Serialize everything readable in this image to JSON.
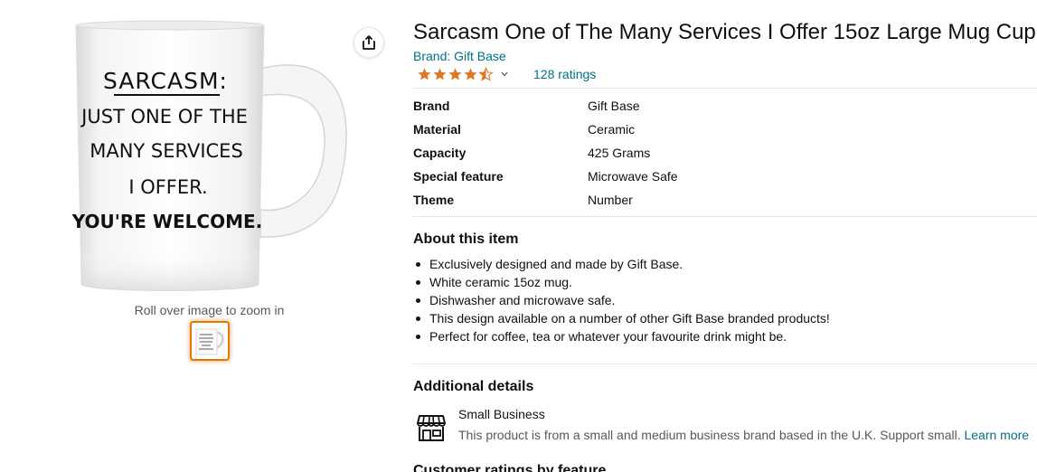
{
  "image": {
    "zoom_hint": "Roll over image to zoom in",
    "mug_text": [
      "SARCASM:",
      "JUST ONE OF THE",
      "MANY SERVICES",
      "I OFFER.",
      "YOU'RE WELCOME."
    ]
  },
  "product": {
    "title": "Sarcasm One of The Many Services I Offer 15oz Large Mug Cup",
    "brand_link": "Brand: Gift Base",
    "rating": 4.5,
    "ratings_count": "128 ratings",
    "star_color": "#de7921"
  },
  "specs": [
    {
      "key": "Brand",
      "value": "Gift Base"
    },
    {
      "key": "Material",
      "value": "Ceramic"
    },
    {
      "key": "Capacity",
      "value": "425 Grams"
    },
    {
      "key": "Special feature",
      "value": "Microwave Safe"
    },
    {
      "key": "Theme",
      "value": "Number"
    }
  ],
  "about": {
    "heading": "About this item",
    "bullets": [
      "Exclusively designed and made by Gift Base.",
      "White ceramic 15oz mug.",
      "Dishwasher and microwave safe.",
      "This design available on a number of other Gift Base branded products!",
      "Perfect for coffee, tea or whatever your favourite drink might be."
    ]
  },
  "additional": {
    "heading": "Additional details",
    "small_business_title": "Small Business",
    "small_business_desc": "This product is from a small and medium business brand based in the U.K. Support small.",
    "learn_more": "Learn more"
  },
  "next_section_heading": "Customer ratings by feature",
  "colors": {
    "link": "#007185",
    "thumb_border": "#e77600"
  }
}
